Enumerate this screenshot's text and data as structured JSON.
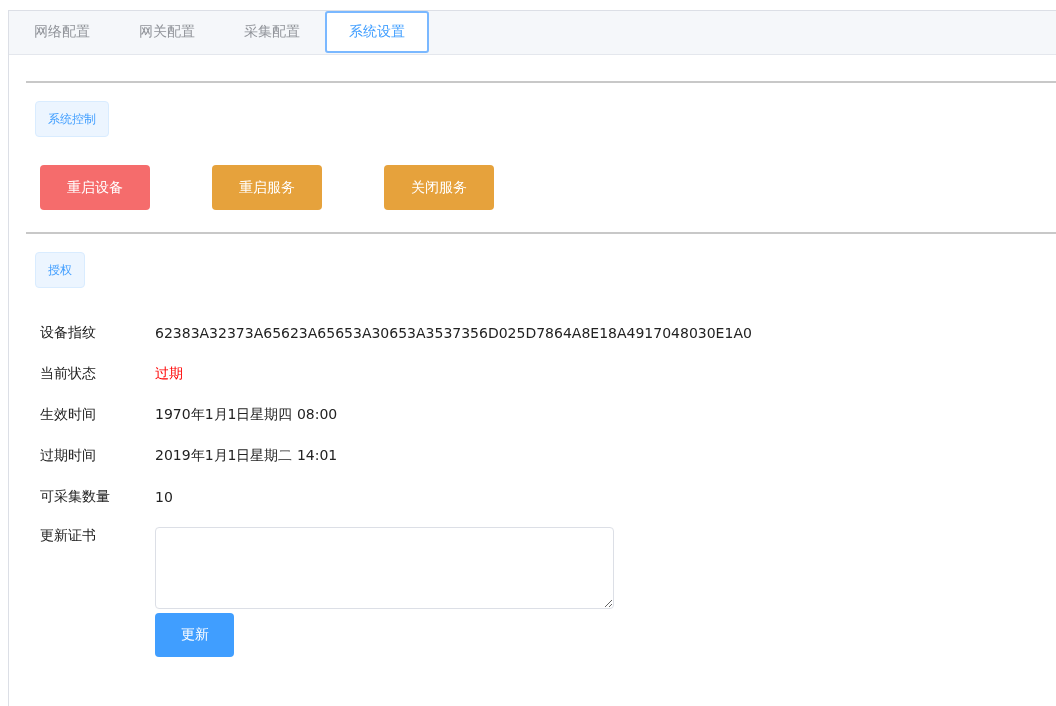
{
  "tabs": [
    {
      "label": "网络配置",
      "selected": false
    },
    {
      "label": "网关配置",
      "selected": false
    },
    {
      "label": "采集配置",
      "selected": false
    },
    {
      "label": "系统设置",
      "selected": true
    }
  ],
  "control_section": {
    "tag": "系统控制",
    "buttons": [
      {
        "label": "重启设备",
        "kind": "danger"
      },
      {
        "label": "重启服务",
        "kind": "warning"
      },
      {
        "label": "关闭服务",
        "kind": "warning"
      }
    ]
  },
  "license_section": {
    "tag": "授权",
    "fields": [
      {
        "label": "设备指纹",
        "value": "62383A32373A65623A65653A30653A3537356D025D7864A8E18A4917048030E1A0",
        "alert": false
      },
      {
        "label": "当前状态",
        "value": "过期",
        "alert": true
      },
      {
        "label": "生效时间",
        "value": "1970年1月1日星期四 08:00",
        "alert": false
      },
      {
        "label": "过期时间",
        "value": "2019年1月1日星期二 14:01",
        "alert": false
      },
      {
        "label": "可采集数量",
        "value": "10",
        "alert": false
      }
    ],
    "certificate": {
      "label": "更新证书"
    },
    "submit": "更新"
  }
}
